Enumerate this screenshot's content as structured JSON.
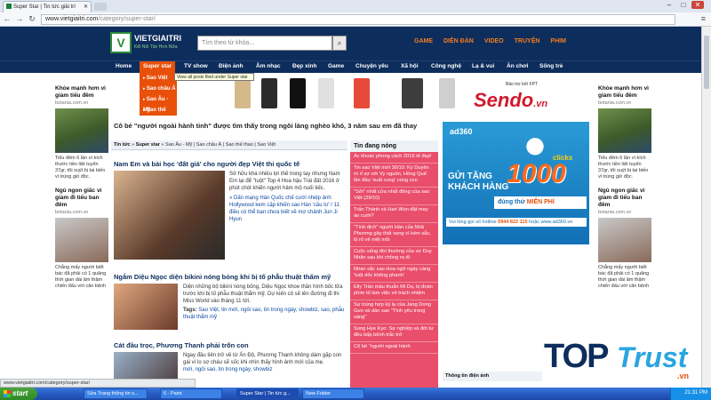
{
  "browser": {
    "tab_title": "Super Star | Tin tức giải trí",
    "url_host": "www.vietgiaitri.com",
    "url_path": "/category/super-star/"
  },
  "site": {
    "logo_text": "VIETGIAITRI",
    "logo_sub": "Kết Nối Tận Hơn Nữa",
    "search_placeholder": "Tìm theo từ khóa...",
    "top_nav": [
      "GAME",
      "DIỄN ĐÀN",
      "VIDEO",
      "TRUYỆN",
      "PHIM"
    ],
    "main_nav": [
      "Home",
      "Super star",
      "TV show",
      "Điện ảnh",
      "Âm nhạc",
      "Đẹp xinh",
      "Game",
      "Chuyện yêu",
      "Xã hội",
      "Công nghệ",
      "Lạ & vui",
      "Ăn chơi",
      "Sống trẻ"
    ],
    "dropdown": [
      "Sao Việt",
      "Sao châu Á",
      "Sao Âu - Mỹ",
      "Sao thế thao"
    ],
    "tooltip": "View all posts filed under Super star"
  },
  "ticker": "Cô bé \"người ngoài hành tinh\" được tìm thấy trong ngôi làng nghèo khó, 3 năm sau em đã thay",
  "breadcrumb": {
    "label": "Tin tức",
    "current": "Super star",
    "links": "Sao Âu - Mỹ | Sao châu Á | Sao thế thao | Sao Việt"
  },
  "articles": [
    {
      "title": "Nam Em và bài học 'đất giá' cho người đẹp Việt thi quốc tế",
      "text": "Sở hữu khá nhiều lợi thế trong tay nhưng Nam Em lại để \"tuột\" Top 4 Hoa hậu Trái đất 2016 ở phút chót khiến người hâm mộ nuối tiếc.",
      "related": "» Dấn mạng Hàn Quốc chế cười nhiệp ảnh Hollywood kem cặp khiến sao Hàn 'cầu lư' / 11 điều có thể bạn chưa biết về mợ chảnh Jun Ji Hyun"
    },
    {
      "title": "Ngắm Diệu Ngọc diện bikini nóng bỏng khi bị tố phẫu thuật thẩm mỹ",
      "text": "Diện những bộ bikini nóng bỏng, Diệu Ngọc khoe thân hình bốc lửa trước khi bị tố phẫu thuật thẩm mỹ. Dự kiến cô sẽ lên đường đi thi Miss World vào tháng 11 tới.",
      "tags_label": "Tags:",
      "tags": "Sao Việt, tin mới, ngôi sao, tin trong ngày, showbiz, sao, phẫu thuật thẩm mỹ"
    },
    {
      "title": "Cát đầu trọc, Phương Thanh phải trốn con",
      "text": "Ngay đầu tiên trở về từ Ấn Độ, Phương Thanh không dám gặp con gái vì lo sợ cháu sẽ sốc khi nhìn thấy hình ảnh mới của mẹ.",
      "tags": "mới, ngôi sao, tin trong ngày, showbiz"
    }
  ],
  "news_box": {
    "title": "Tin đang nóng",
    "items": [
      "Ác khoác phong cách 2016 tế đẹp!",
      "Tin sao Việt mới 30/10: Ký Duyên rò rỉ vợ với Vy nguồn, Hồng Quế lần đầu 'xuất cung' cùng con",
      "\"Sởi\" nhất cửa nhất động của sao Việt (29/10)",
      "Trấn Thành và Hari Won đặt may áo cưới?",
      "\"Tình địch\" người Hàn của Nhã Phương gây thất vọng vì kém sắc, lộ rõ vẻ mệt mỏi",
      "Cuộc sống đời thường của vợ Duy Nhân sau khi chồng ra đi",
      "Nhan sắc sao Hoa ngữ ngày càng 'tuột dốc không phanh'",
      "Elly Trần mâu thuẫn Mi Du, bị đoàn phim tố làm việc vô trách nhiệm",
      "Sự trùng hợp kỳ lạ của Jang Dong Gun và dàn sao \"Tình yêu trong sáng\"",
      "Song Hye Kyo: Sự nghiệp và đời tư đều bấp bênh trắc trở",
      "Cô bé \"người ngoài hành"
    ]
  },
  "side_left": [
    {
      "title": "Khỏe mạnh hơn vì giảm tiểu đêm",
      "source": "botania.com.vn",
      "desc": "Tiểu đêm 6 lần vì kích thước tiền liệt tuyến 37gr, tôi suýt bị tai biến vì trúng gió độc."
    },
    {
      "title": "Ngủ ngon giấc vì giảm đi tiểu ban đêm",
      "source": "botania.com.vn",
      "desc": "Chẳng mấy người biết bác đã phải có 1 quãng thời gian dài ăm thậm chiến đấu với căn bệnh"
    }
  ],
  "side_right": [
    {
      "title": "Khỏe mạnh hơn vì giảm tiểu đêm",
      "source": "botania.com.vn",
      "desc": "Tiểu đêm 6 lần vì kích thước tiền liệt tuyến 37gr, tôi suýt bị tai biến vì trúng gió độc."
    },
    {
      "title": "Ngủ ngon giấc vì giảm đi tiểu ban đêm",
      "source": "botania.com.vn",
      "desc": "Chẳng mấy người biết bác đã phải có 1 quãng thời gian dài ăm thậm chiến đấu với căn bệnh"
    }
  ],
  "ads": {
    "sendo_tag": "Bảo trợ bởi FPT",
    "sendo_brand": "Sendo",
    "sendo_tld": ".vn",
    "ad360_brand": "ad360",
    "ad360_gift": "GỬI TẶNG\nKHÁCH HÀNG",
    "ad360_amount": "1000",
    "ad360_clicks": "clicks",
    "ad360_free_pre": "đúng thứ",
    "ad360_free": "MIỄN PHÍ",
    "ad360_hotline_pre": "Vui lòng gọi số hotline",
    "ad360_hotline": "0944 822 115",
    "ad360_hotline_post": "hoặc www.ad360.vn"
  },
  "watermark": {
    "top": "TOP",
    "trust": "Trust",
    ".vn": ".vn"
  },
  "tong_hop": "Thông tin điện ảnh",
  "status_url": "www.vietgiaitri.com/category/super-star/",
  "taskbar": {
    "start": "start",
    "tasks": [
      "Sửa Trang thông tin s...",
      "6 - Paint",
      "Super Star | Tin tức g...",
      "New Folder"
    ],
    "clock": "21:31 PM"
  },
  "colors": {
    "nav_bg": "#0d2d5c",
    "accent": "#e8500a",
    "news_bg": "#e94e6b"
  }
}
